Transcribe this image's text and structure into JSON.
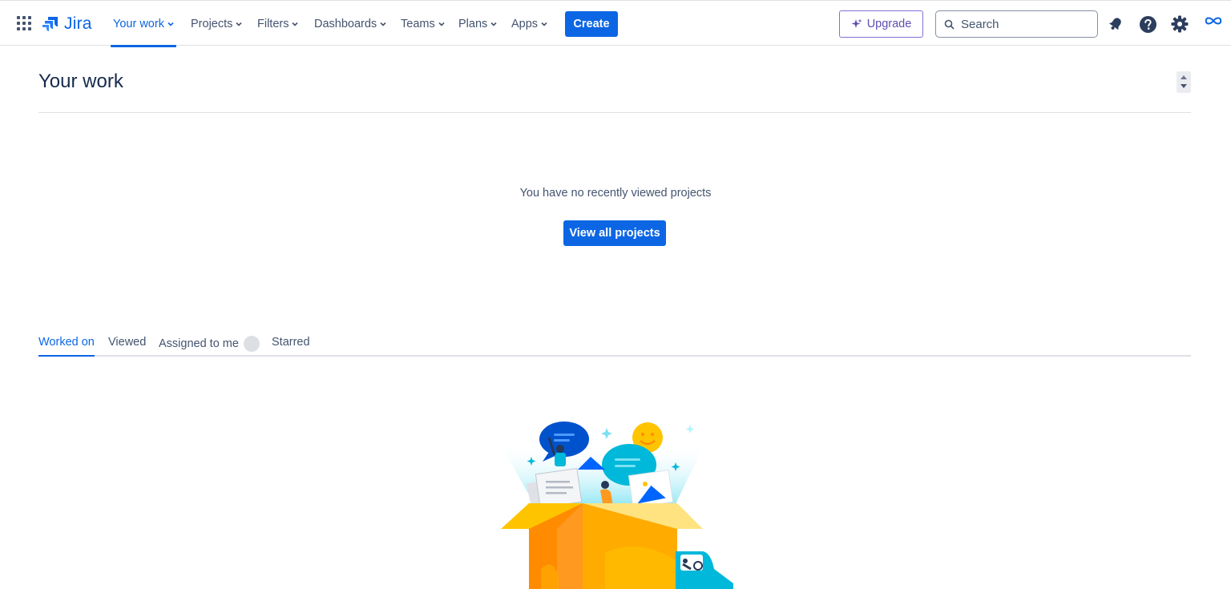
{
  "app": {
    "name": "Jira"
  },
  "nav": {
    "items": [
      {
        "label": "Your work",
        "active": true
      },
      {
        "label": "Projects",
        "active": false
      },
      {
        "label": "Filters",
        "active": false
      },
      {
        "label": "Dashboards",
        "active": false
      },
      {
        "label": "Teams",
        "active": false
      },
      {
        "label": "Plans",
        "active": false
      },
      {
        "label": "Apps",
        "active": false
      }
    ],
    "create_label": "Create",
    "upgrade_label": "Upgrade",
    "search_placeholder": "Search"
  },
  "main": {
    "title": "Your work",
    "empty_message": "You have no recently viewed projects",
    "view_all_label": "View all projects",
    "tabs": [
      {
        "label": "Worked on",
        "active": true
      },
      {
        "label": "Viewed",
        "active": false
      },
      {
        "label": "Assigned to me",
        "active": false
      },
      {
        "label": "Starred",
        "active": false
      }
    ]
  },
  "colors": {
    "brand": "#0c66e4",
    "text": "#172b4d",
    "subtle_text": "#44546f",
    "upgrade": "#5e4db2"
  },
  "icons": [
    "app-switcher-icon",
    "jira-logo-icon",
    "chevron-down-icon",
    "sparkle-icon",
    "search-icon",
    "notification-bell-icon",
    "help-icon",
    "settings-gear-icon",
    "profile-loop-icon"
  ]
}
